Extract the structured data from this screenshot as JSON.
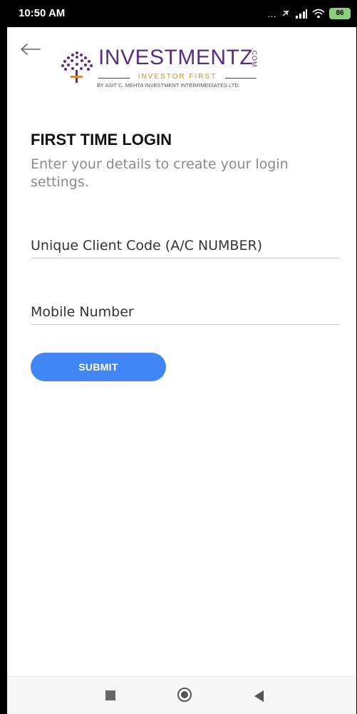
{
  "status_bar": {
    "time": "10:50 AM",
    "signal": "…",
    "battery": "86"
  },
  "logo": {
    "title": "INVESTMENTZ",
    "domain": ".COM",
    "tagline": "INVESTOR FIRST",
    "byline": "BY ASIT C. MEHTA INVESTMENT INTERRMEDIATES LTD."
  },
  "page": {
    "title": "FIRST TIME LOGIN",
    "description": "Enter your details to create your login settings."
  },
  "form": {
    "client_code_placeholder": "Unique Client Code (A/C NUMBER)",
    "client_code_value": "",
    "mobile_placeholder": "Mobile Number",
    "mobile_value": "",
    "submit_label": "SUBMIT"
  },
  "colors": {
    "brand": "#5a2d84",
    "accent": "#e58a23",
    "button": "#4285f4"
  },
  "icons": [
    "back-arrow-icon",
    "nav-recents-icon",
    "nav-home-icon",
    "nav-back-icon"
  ]
}
